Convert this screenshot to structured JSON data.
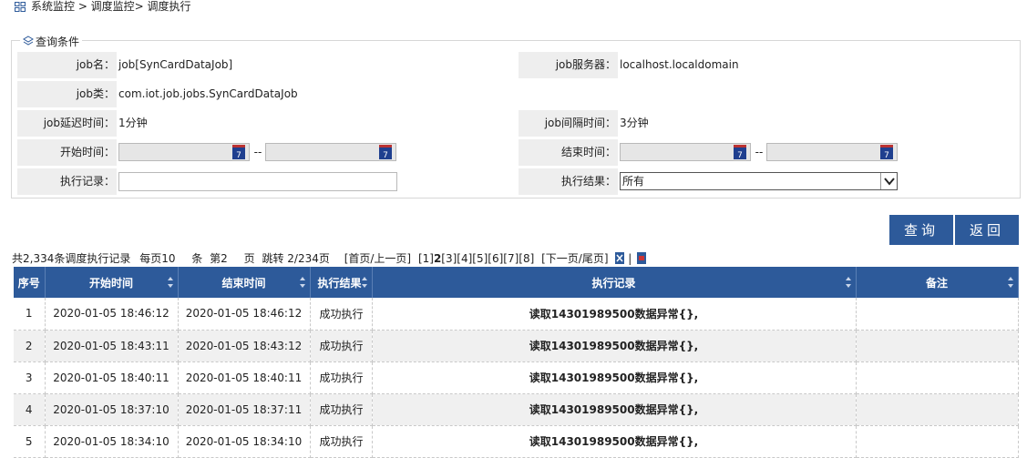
{
  "breadcrumb": {
    "text": "系统监控 > 调度监控> 调度执行",
    "icon": "grid-icon"
  },
  "query": {
    "legend": "查询条件",
    "job_name_label": "job名：",
    "job_name_value": "job[SynCardDataJob]",
    "job_server_label": "job服务器：",
    "job_server_value": "localhost.localdomain",
    "job_class_label": "job类：",
    "job_class_value": "com.iot.job.jobs.SynCardDataJob",
    "job_delay_label": "job延迟时间：",
    "job_delay_value": "1分钟",
    "job_interval_label": "job间隔时间：",
    "job_interval_value": "3分钟",
    "start_time_label": "开始时间：",
    "end_time_label": "结束时间：",
    "date_separator": "--",
    "exec_record_label": "执行记录：",
    "exec_result_label": "执行结果：",
    "exec_result_selected": "所有",
    "calendar_glyph": "7"
  },
  "buttons": {
    "query": "查询",
    "back": "返回"
  },
  "pager": {
    "summary": "共2,334条调度执行记录",
    "per_page_prefix": "每页10",
    "per_page_suffix": "条",
    "page_prefix": "第2",
    "page_suffix": "页",
    "jump": "跳转 2/234页",
    "first_prev": "[首页/上一页]",
    "p1": "[1]",
    "p2": "2",
    "p3": "[3]",
    "p4": "[4]",
    "p5": "[5]",
    "p6": "[6]",
    "p7": "[7]",
    "p8": "[8]",
    "next_last": "[下一页/尾页]",
    "separator": "|"
  },
  "table": {
    "headers": {
      "seq": "序号",
      "start": "开始时间",
      "end": "结束时间",
      "result": "执行结果",
      "record": "执行记录",
      "note": "备注"
    },
    "rows": [
      {
        "seq": "1",
        "start": "2020-01-05 18:46:12",
        "end": "2020-01-05 18:46:12",
        "result": "成功执行",
        "record": "读取14301989500数据异常{},",
        "note": ""
      },
      {
        "seq": "2",
        "start": "2020-01-05 18:43:11",
        "end": "2020-01-05 18:43:12",
        "result": "成功执行",
        "record": "读取14301989500数据异常{},",
        "note": ""
      },
      {
        "seq": "3",
        "start": "2020-01-05 18:40:11",
        "end": "2020-01-05 18:40:11",
        "result": "成功执行",
        "record": "读取14301989500数据异常{},",
        "note": ""
      },
      {
        "seq": "4",
        "start": "2020-01-05 18:37:10",
        "end": "2020-01-05 18:37:11",
        "result": "成功执行",
        "record": "读取14301989500数据异常{},",
        "note": ""
      },
      {
        "seq": "5",
        "start": "2020-01-05 18:34:10",
        "end": "2020-01-05 18:34:10",
        "result": "成功执行",
        "record": "读取14301989500数据异常{},",
        "note": ""
      }
    ]
  },
  "colors": {
    "header_blue": "#2d5a9a",
    "label_bg": "#eeeeee",
    "alt_row": "#f0f0f0"
  }
}
